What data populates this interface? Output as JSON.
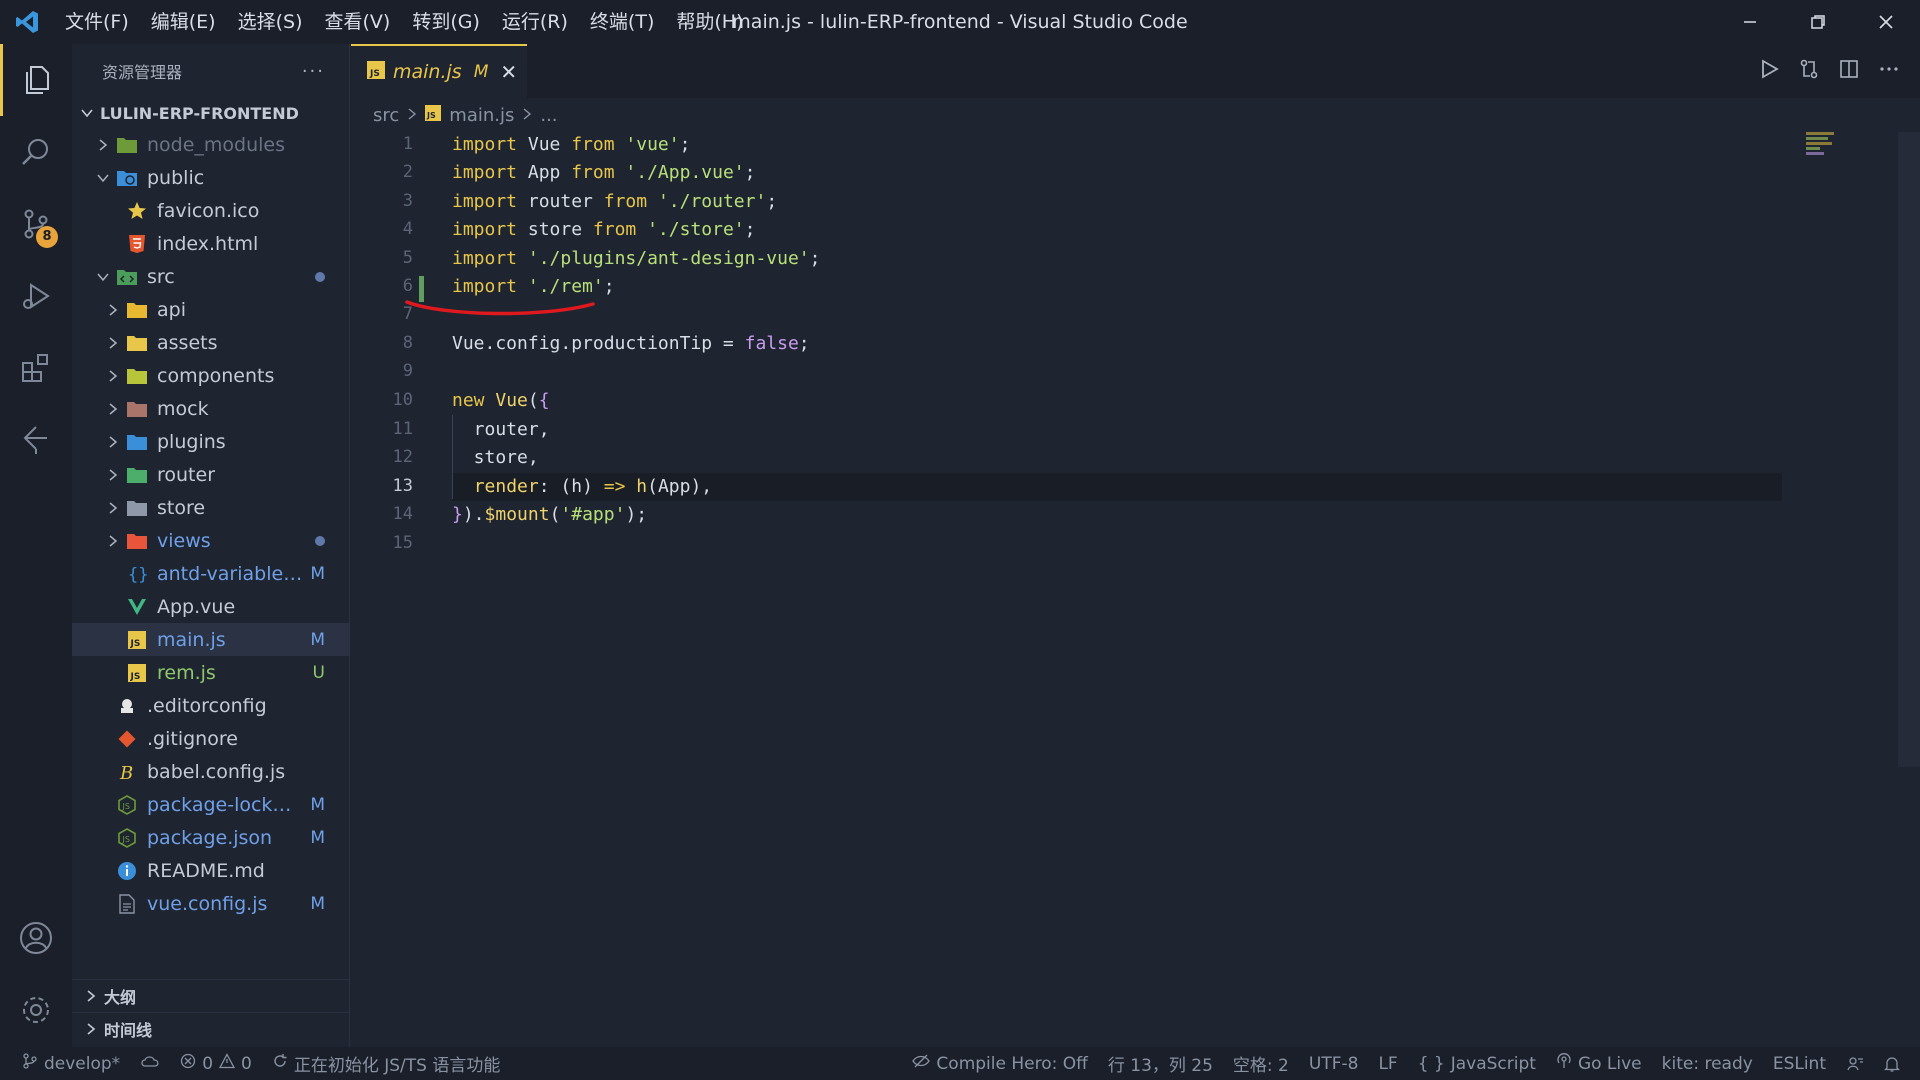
{
  "titlebar": {
    "menu": [
      "文件(F)",
      "编辑(E)",
      "选择(S)",
      "查看(V)",
      "转到(G)",
      "运行(R)",
      "终端(T)",
      "帮助(H)"
    ],
    "title": "main.js - lulin-ERP-frontend - Visual Studio Code"
  },
  "activity": {
    "scm_badge": "8"
  },
  "sidebar": {
    "title": "资源管理器",
    "more": "···",
    "project": "LULIN-ERP-FRONTEND",
    "items": [
      {
        "name": "node_modules",
        "indent": 1,
        "chevron": "right",
        "icon": "folder-node-icon",
        "color": "#6b7484",
        "flag": ""
      },
      {
        "name": "public",
        "indent": 1,
        "chevron": "down",
        "icon": "folder-public-icon",
        "color": "#c5cbd6",
        "flag": ""
      },
      {
        "name": "favicon.ico",
        "indent": 2,
        "chevron": "",
        "icon": "star-icon",
        "color": "#c5cbd6",
        "flag": ""
      },
      {
        "name": "index.html",
        "indent": 2,
        "chevron": "",
        "icon": "html-icon",
        "color": "#c5cbd6",
        "flag": ""
      },
      {
        "name": "src",
        "indent": 1,
        "chevron": "down",
        "icon": "folder-src-icon",
        "color": "#c5cbd6",
        "flag": "dot"
      },
      {
        "name": "api",
        "indent": 2,
        "chevron": "right",
        "icon": "folder-api-icon",
        "color": "#c5cbd6",
        "flag": ""
      },
      {
        "name": "assets",
        "indent": 2,
        "chevron": "right",
        "icon": "folder-assets-icon",
        "color": "#c5cbd6",
        "flag": ""
      },
      {
        "name": "components",
        "indent": 2,
        "chevron": "right",
        "icon": "folder-components-icon",
        "color": "#c5cbd6",
        "flag": ""
      },
      {
        "name": "mock",
        "indent": 2,
        "chevron": "right",
        "icon": "folder-mock-icon",
        "color": "#c5cbd6",
        "flag": ""
      },
      {
        "name": "plugins",
        "indent": 2,
        "chevron": "right",
        "icon": "folder-plugins-icon",
        "color": "#c5cbd6",
        "flag": ""
      },
      {
        "name": "router",
        "indent": 2,
        "chevron": "right",
        "icon": "folder-router-icon",
        "color": "#c5cbd6",
        "flag": ""
      },
      {
        "name": "store",
        "indent": 2,
        "chevron": "right",
        "icon": "folder-store-icon",
        "color": "#c5cbd6",
        "flag": ""
      },
      {
        "name": "views",
        "indent": 2,
        "chevron": "right",
        "icon": "folder-views-icon",
        "color": "#6fa0e8",
        "flag": "dot"
      },
      {
        "name": "antd-variables.less",
        "indent": 2,
        "chevron": "",
        "icon": "braces-icon",
        "color": "#6fa0e8",
        "flag": "M"
      },
      {
        "name": "App.vue",
        "indent": 2,
        "chevron": "",
        "icon": "vue-icon",
        "color": "#c5cbd6",
        "flag": ""
      },
      {
        "name": "main.js",
        "indent": 2,
        "chevron": "",
        "icon": "js-icon",
        "color": "#6fa0e8",
        "flag": "M",
        "selected": true
      },
      {
        "name": "rem.js",
        "indent": 2,
        "chevron": "",
        "icon": "js-icon",
        "color": "#8fc86b",
        "flag": "U"
      },
      {
        "name": ".editorconfig",
        "indent": 1,
        "chevron": "",
        "icon": "editorconfig-icon",
        "color": "#c5cbd6",
        "flag": ""
      },
      {
        "name": ".gitignore",
        "indent": 1,
        "chevron": "",
        "icon": "git-icon",
        "color": "#c5cbd6",
        "flag": ""
      },
      {
        "name": "babel.config.js",
        "indent": 1,
        "chevron": "",
        "icon": "babel-icon",
        "color": "#c5cbd6",
        "flag": ""
      },
      {
        "name": "package-lock.json",
        "indent": 1,
        "chevron": "",
        "icon": "nodejs-icon",
        "color": "#6fa0e8",
        "flag": "M"
      },
      {
        "name": "package.json",
        "indent": 1,
        "chevron": "",
        "icon": "nodejs-icon",
        "color": "#6fa0e8",
        "flag": "M"
      },
      {
        "name": "README.md",
        "indent": 1,
        "chevron": "",
        "icon": "info-icon",
        "color": "#c5cbd6",
        "flag": ""
      },
      {
        "name": "vue.config.js",
        "indent": 1,
        "chevron": "",
        "icon": "config-file-icon",
        "color": "#6fa0e8",
        "flag": "M"
      }
    ],
    "sections": [
      "大纲",
      "时间线"
    ]
  },
  "tab": {
    "name": "main.js",
    "flag": "M",
    "close": "✕"
  },
  "breadcrumb": {
    "folder": "src",
    "file": "main.js",
    "more": "..."
  },
  "editor": {
    "line_numbers": [
      "1",
      "2",
      "3",
      "4",
      "5",
      "6",
      "7",
      "8",
      "9",
      "10",
      "11",
      "12",
      "13",
      "14",
      "15"
    ],
    "current_line": 13
  },
  "statusbar": {
    "branch": "develop*",
    "errors": "0",
    "warnings": "0",
    "task": "正在初始化 JS/TS 语言功能",
    "compile_hero": "Compile Hero: Off",
    "position": "行 13，列 25",
    "spaces": "空格: 2",
    "encoding": "UTF-8",
    "eol": "LF",
    "language": "JavaScript",
    "go_live": "Go Live",
    "kite": "kite: ready",
    "eslint": "ESLint"
  },
  "colors": {
    "accent": "#e8c64a",
    "modified": "#6fa0e8",
    "untracked": "#8fc86b",
    "annotation": "#e0191f"
  }
}
